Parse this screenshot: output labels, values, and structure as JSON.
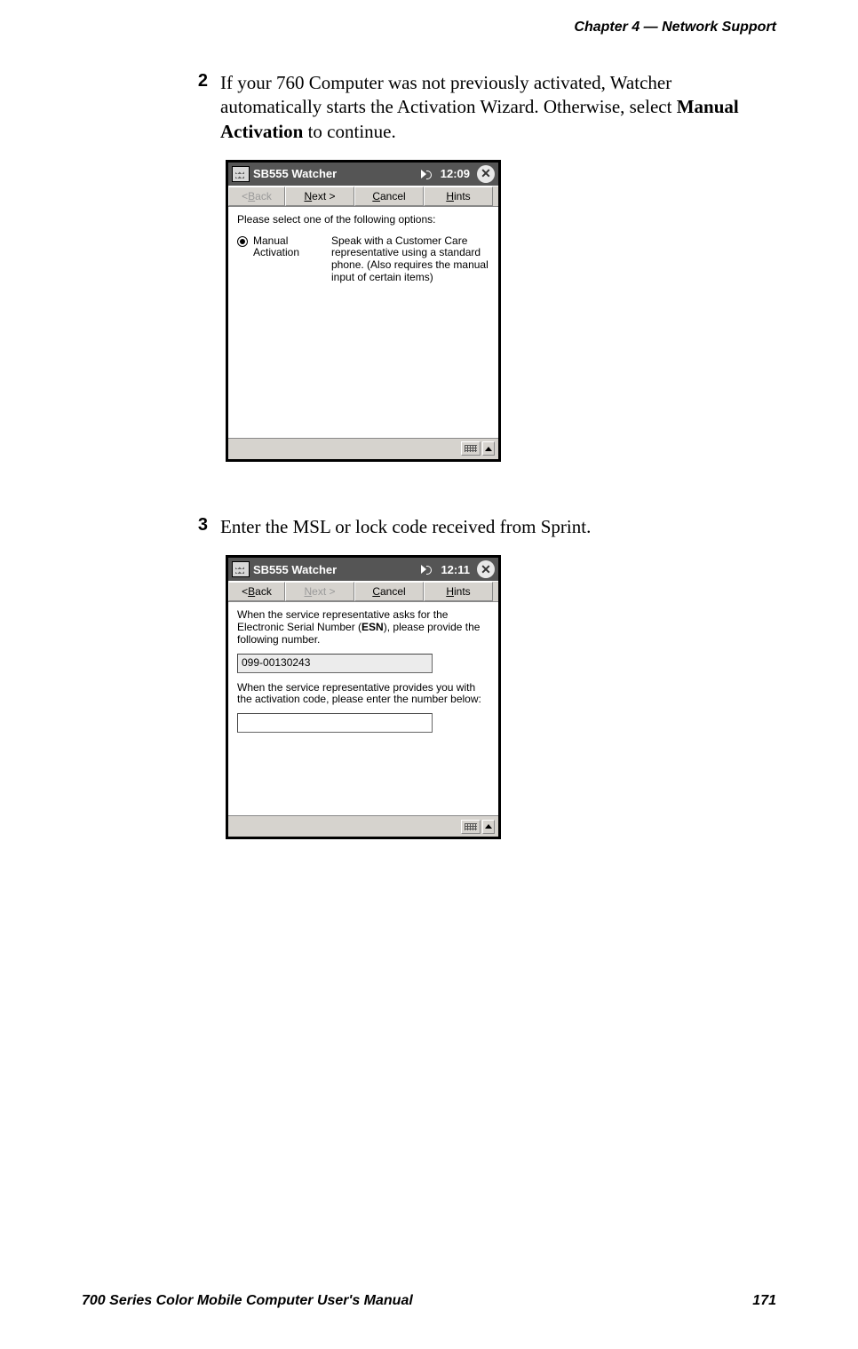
{
  "header": {
    "chapter_ref": "Chapter  4  —  Network Support"
  },
  "footer": {
    "manual_title": "700 Series Color Mobile Computer User's Manual",
    "page_number": "171"
  },
  "steps": {
    "step2": {
      "num": "2",
      "text_before": "If your 760 Computer was not previously activated, Watcher automatically starts the Activation Wizard. Otherwise, select ",
      "bold": "Manual Activation",
      "text_after": " to continue."
    },
    "step3": {
      "num": "3",
      "text": "Enter the MSL or lock code received from Sprint."
    }
  },
  "screenshot1": {
    "title": "SB555 Watcher",
    "time": "12:09",
    "toolbar": {
      "back_prefix": "< ",
      "back_underline": "B",
      "back_suffix": "ack",
      "next_underline": "N",
      "next_suffix": "ext >",
      "cancel_underline": "C",
      "cancel_suffix": "ancel",
      "hints_underline": "H",
      "hints_suffix": "ints"
    },
    "instruction": "Please select one of the following options:",
    "radio": {
      "label": "Manual Activation",
      "desc": "Speak with a Customer Care representative using a standard phone. (Also requires the manual input of certain items)"
    }
  },
  "screenshot2": {
    "title": "SB555 Watcher",
    "time": "12:11",
    "toolbar": {
      "back_prefix": "< ",
      "back_underline": "B",
      "back_suffix": "ack",
      "next_underline": "N",
      "next_suffix": "ext >",
      "cancel_underline": "C",
      "cancel_suffix": "ancel",
      "hints_underline": "H",
      "hints_suffix": "ints"
    },
    "text1_before": "When the service representative asks for the Electronic Serial Number (",
    "text1_bold": "ESN",
    "text1_after": "), please provide the following number.",
    "esn_value": "099-00130243",
    "text2": "When the service representative provides you with the activation code, please enter the number below:"
  }
}
